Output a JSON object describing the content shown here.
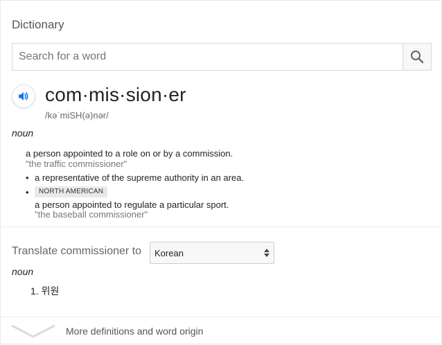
{
  "panel": {
    "title": "Dictionary",
    "search_placeholder": "Search for a word"
  },
  "entry": {
    "headword": "com·mis·sion·er",
    "phonetic": "/kəˈmiSH(ə)nər/",
    "part_of_speech": "noun",
    "senses": [
      {
        "definition": "a person appointed to a role on or by a commission.",
        "example": "\"the traffic commissioner\""
      },
      {
        "definition": "a representative of the supreme authority in an area."
      },
      {
        "region": "NORTH AMERICAN",
        "definition": "a person appointed to regulate a particular sport.",
        "example": "\"the baseball commissioner\""
      }
    ]
  },
  "translate": {
    "label": "Translate commissioner to",
    "language": "Korean",
    "part_of_speech": "noun",
    "items": [
      "1. 위원"
    ]
  },
  "more": {
    "label": "More definitions and word origin"
  },
  "icons": {
    "search": "search-icon",
    "speaker": "speaker-icon",
    "expand": "chevron-down-icon"
  },
  "colors": {
    "accent_blue": "#1a73e8",
    "muted_text": "#777777",
    "border": "#d9d9d9"
  }
}
